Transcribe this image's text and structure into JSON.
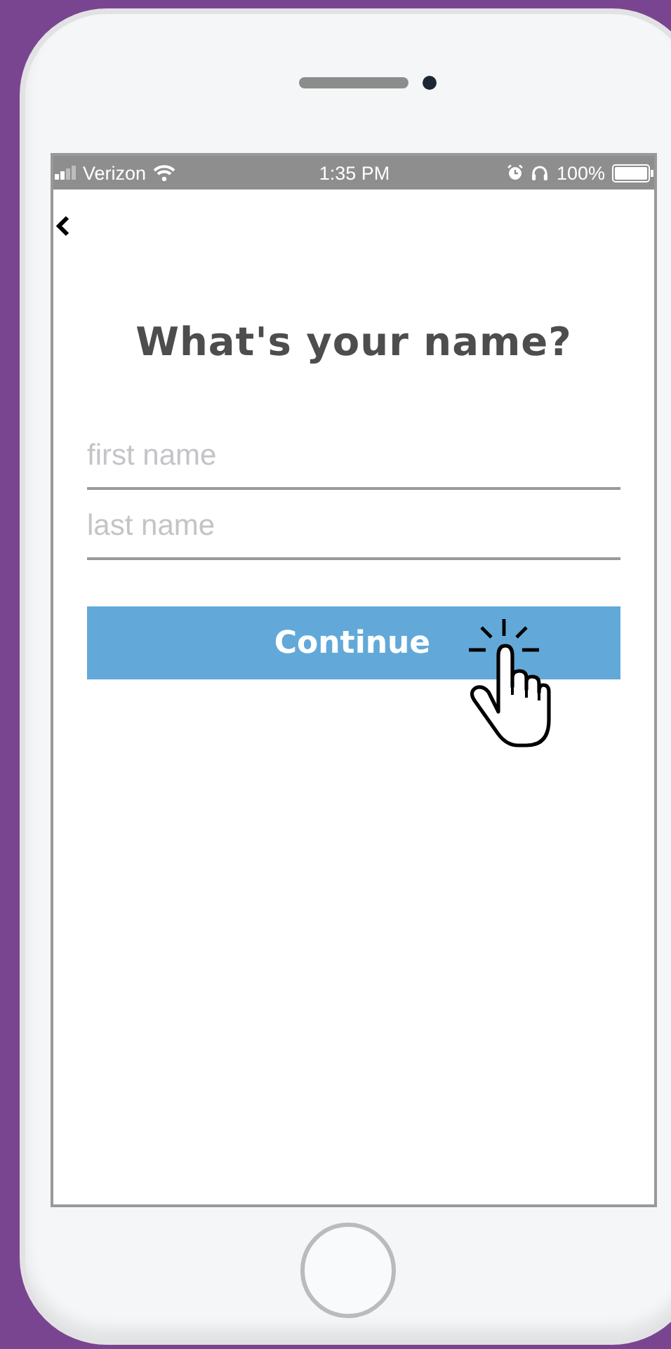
{
  "status_bar": {
    "carrier": "Verizon",
    "time": "1:35 PM",
    "battery": "100%"
  },
  "title": "What's your name?",
  "fields": [
    {
      "placeholder": "first name"
    },
    {
      "placeholder": "last name"
    }
  ],
  "continue_button": {
    "label": "Continue"
  }
}
